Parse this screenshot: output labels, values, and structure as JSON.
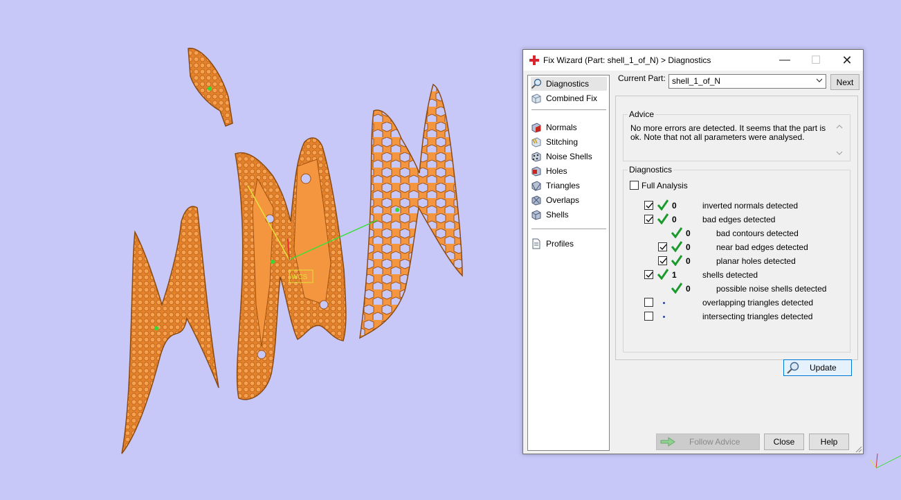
{
  "viewport": {
    "wcs_label": "WCS"
  },
  "dialog": {
    "title": "Fix Wizard (Part: shell_1_of_N) > Diagnostics",
    "title_icon": "red-cross-icon",
    "controls": {
      "minimize": "—",
      "maximize": "☐",
      "close": "✕"
    }
  },
  "nav": {
    "items": [
      {
        "label": "Diagnostics",
        "icon": "magnifier-icon"
      },
      {
        "label": "Combined Fix",
        "icon": "cube-icon"
      },
      {
        "label": "Normals",
        "icon": "normals-cube-icon"
      },
      {
        "label": "Stitching",
        "icon": "stitching-icon"
      },
      {
        "label": "Noise Shells",
        "icon": "noise-shells-icon"
      },
      {
        "label": "Holes",
        "icon": "holes-icon"
      },
      {
        "label": "Triangles",
        "icon": "triangles-icon"
      },
      {
        "label": "Overlaps",
        "icon": "overlaps-icon"
      },
      {
        "label": "Shells",
        "icon": "shells-icon"
      },
      {
        "label": "Profiles",
        "icon": "document-icon"
      }
    ]
  },
  "current_part": {
    "label": "Current Part:",
    "value": "shell_1_of_N",
    "next": "Next"
  },
  "advice": {
    "label": "Advice",
    "text": "No more errors are detected. It seems that the part is ok. Note that not all parameters were analysed."
  },
  "diagnostics": {
    "label": "Diagnostics",
    "full_analysis": "Full Analysis",
    "rows": [
      {
        "count": "0",
        "label": "inverted normals detected"
      },
      {
        "count": "0",
        "label": "bad edges detected"
      },
      {
        "count": "0",
        "label": "bad contours detected"
      },
      {
        "count": "0",
        "label": "near bad edges detected"
      },
      {
        "count": "0",
        "label": "planar holes detected"
      },
      {
        "count": "1",
        "label": "shells detected"
      },
      {
        "count": "0",
        "label": "possible noise shells detected"
      },
      {
        "count": "",
        "label": "overlapping triangles detected"
      },
      {
        "count": "",
        "label": "intersecting triangles detected"
      }
    ],
    "update": "Update"
  },
  "footer": {
    "follow_advice": "Follow Advice",
    "close": "Close",
    "help": "Help"
  },
  "colors": {
    "model": "#f4953f",
    "background": "#c7c7f8",
    "check_green": "#1a9a2c",
    "accent": "#0078d7"
  }
}
